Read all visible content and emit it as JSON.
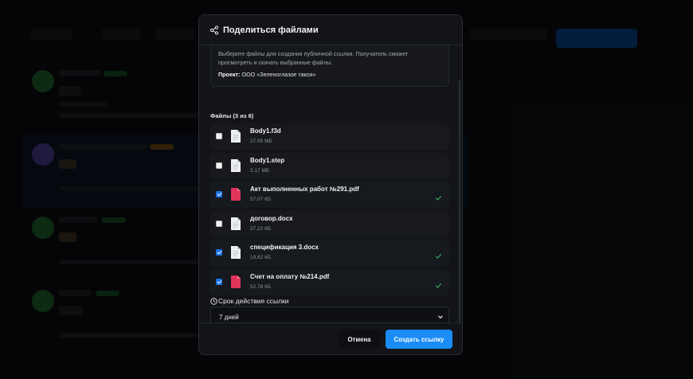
{
  "dialog": {
    "title": "Поделиться файлами",
    "description": "Выберите файлы для создания публичной ссылки. Получатель сможет просмотреть и скачать выбранные файлы.",
    "project_label": "Проект:",
    "project_value": "ООО «Зеленоглазое такси»",
    "files_heading": "Файлы (3 из 6)",
    "files": [
      {
        "name": "Body1.f3d",
        "size": "27.05 МБ",
        "checked": false,
        "type": "doc"
      },
      {
        "name": "Body1.step",
        "size": "2.17 МБ",
        "checked": false,
        "type": "doc"
      },
      {
        "name": "Акт выполненных работ №291.pdf",
        "size": "57.07 КБ",
        "checked": true,
        "type": "pdf"
      },
      {
        "name": "договор.docx",
        "size": "37.22 КБ",
        "checked": false,
        "type": "doc"
      },
      {
        "name": "спецификация 3.docx",
        "size": "19.62 КБ",
        "checked": true,
        "type": "doc"
      },
      {
        "name": "Счет на оплату №214.pdf",
        "size": "52.78 КБ",
        "checked": true,
        "type": "pdf"
      }
    ],
    "expire_label": "Срок действия ссылки",
    "expire_value": "7 дней",
    "cancel_label": "Отмена",
    "create_label": "Создать ссылку"
  },
  "icons": {
    "header": "share-icon",
    "expire": "clock-icon",
    "select": "chevron-down-icon",
    "doc_file": "document-icon",
    "pdf_file": "pdf-icon",
    "checked": "checkmark-icon"
  },
  "colors": {
    "accent": "#1a8cf5",
    "checkbox": "#1a73e8",
    "check_mark": "#3ab26a",
    "pdf": "#e0345a",
    "modal_bg": "#121418"
  }
}
